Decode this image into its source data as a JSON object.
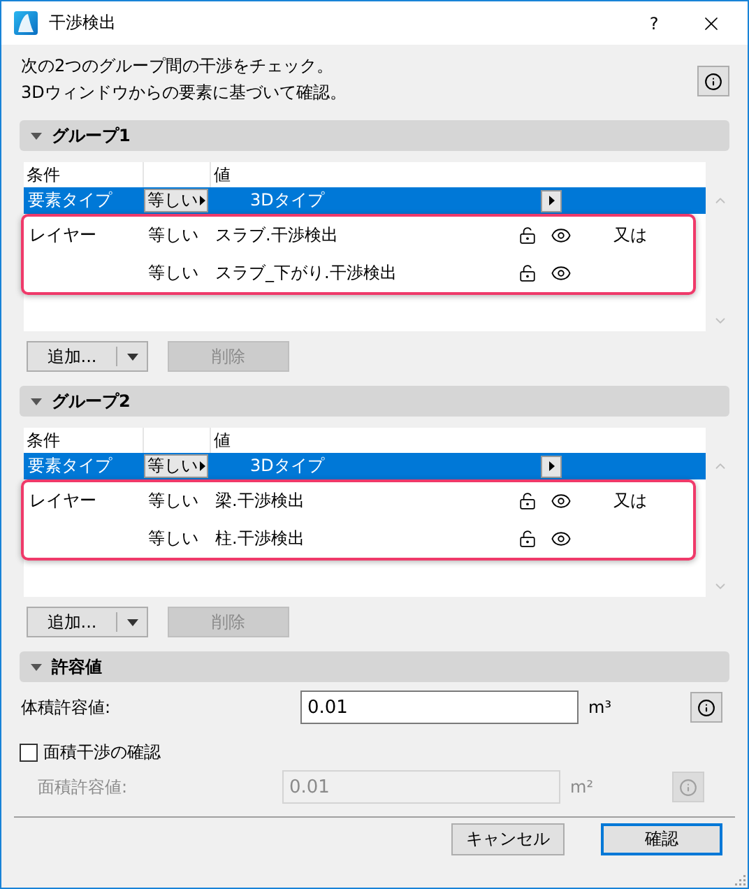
{
  "window": {
    "title": "干渉検出",
    "help": "?"
  },
  "description": [
    "次の2つのグループ間の干渉をチェック。",
    "3Dウィンドウからの要素に基づいて確認。"
  ],
  "groups": [
    {
      "title": "グループ1",
      "expanded": true,
      "columns": [
        "条件",
        "値"
      ],
      "rows": [
        {
          "kind": "type",
          "criterion": "要素タイプ",
          "operator": "等しい",
          "value": "3Dタイプ",
          "selected": true,
          "highlighted": false
        },
        {
          "kind": "layer",
          "criterion": "レイヤー",
          "operator": "等しい",
          "value": "スラブ.干渉検出",
          "connector": "又は",
          "selected": false,
          "highlighted": true
        },
        {
          "kind": "layer",
          "operator": "等しい",
          "value": "スラブ_下がり.干渉検出",
          "selected": false,
          "highlighted": true
        }
      ],
      "add": "追加...",
      "delete": {
        "label": "削除",
        "disabled": true
      }
    },
    {
      "title": "グループ2",
      "expanded": true,
      "columns": [
        "条件",
        "値"
      ],
      "rows": [
        {
          "kind": "type",
          "criterion": "要素タイプ",
          "operator": "等しい",
          "value": "3Dタイプ",
          "selected": true,
          "highlighted": false
        },
        {
          "kind": "layer",
          "criterion": "レイヤー",
          "operator": "等しい",
          "value": "梁.干渉検出",
          "connector": "又は",
          "selected": false,
          "highlighted": true
        },
        {
          "kind": "layer",
          "operator": "等しい",
          "value": "柱.干渉検出",
          "selected": false,
          "highlighted": true
        }
      ],
      "add": "追加...",
      "delete": {
        "label": "削除",
        "disabled": true
      }
    }
  ],
  "tolerance": {
    "title": "許容値",
    "expanded": true,
    "volume": {
      "label": "体積許容値:",
      "value": "0.01",
      "unit": "m³",
      "disabled": false
    },
    "area_check": {
      "label": "面積干渉の確認",
      "checked": false
    },
    "area": {
      "label": "面積許容値:",
      "value": "0.01",
      "unit": "m²",
      "disabled": true
    }
  },
  "buttons": [
    {
      "label": "キャンセル",
      "default": false
    },
    {
      "label": "確認",
      "default": true
    }
  ]
}
